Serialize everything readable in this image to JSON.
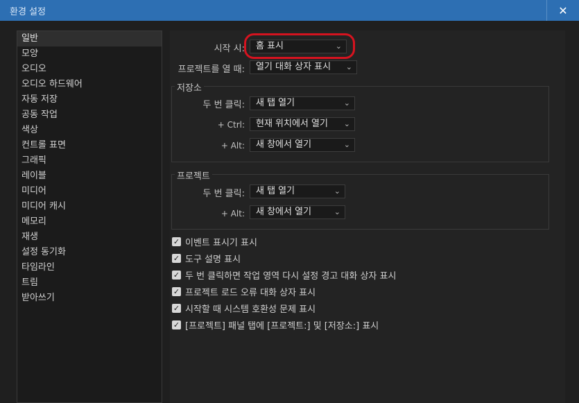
{
  "window": {
    "title": "환경 설정",
    "close_glyph": "✕"
  },
  "sidebar": {
    "items": [
      "일반",
      "모양",
      "오디오",
      "오디오 하드웨어",
      "자동 저장",
      "공동 작업",
      "색상",
      "컨트롤 표면",
      "그래픽",
      "레이블",
      "미디어",
      "미디어 캐시",
      "메모리",
      "재생",
      "설정 동기화",
      "타임라인",
      "트림",
      "받아쓰기"
    ]
  },
  "general": {
    "startup_label": "시작 시:",
    "startup_value": "홈 표시",
    "open_project_label": "프로젝트를 열 때:",
    "open_project_value": "열기 대화 상자 표시"
  },
  "storage_group": {
    "title": "저장소",
    "double_click_label": "두 번 클릭:",
    "double_click_value": "새 탭 열기",
    "ctrl_label": "+ Ctrl:",
    "ctrl_value": "현재 위치에서 열기",
    "alt_label": "+ Alt:",
    "alt_value": "새 창에서 열기"
  },
  "project_group": {
    "title": "프로젝트",
    "double_click_label": "두 번 클릭:",
    "double_click_value": "새 탭 열기",
    "alt_label": "+ Alt:",
    "alt_value": "새 창에서 열기"
  },
  "checkboxes": [
    "이벤트 표시기 표시",
    "도구 설명 표시",
    "두 번 클릭하면 작업 영역 다시 설정 경고 대화 상자 표시",
    "프로젝트 로드 오류 대화 상자 표시",
    "시작할 때 시스템 호환성 문제 표시",
    "[프로젝트] 패널 탭에 [프로젝트:] 및 [저장소:] 표시"
  ],
  "checkbox_glyph": "✓",
  "chevron_glyph": "⌄"
}
